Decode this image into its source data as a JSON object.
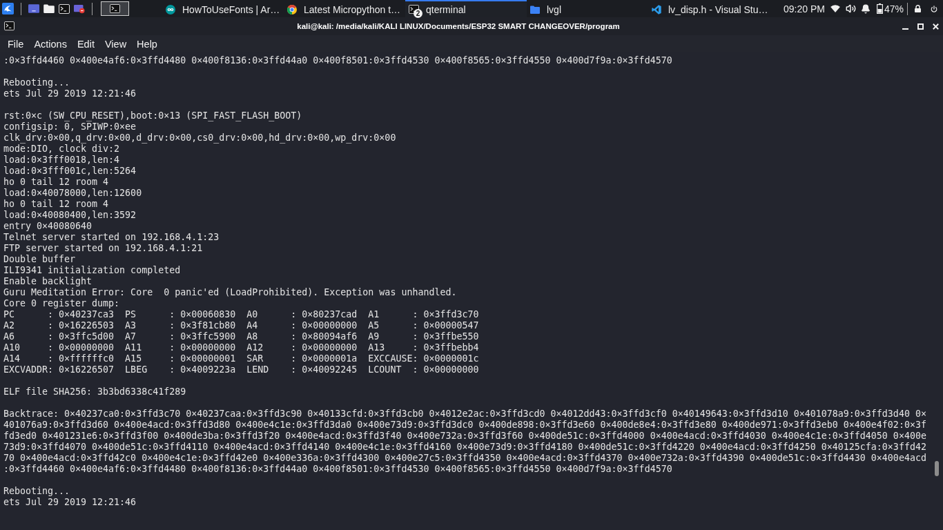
{
  "taskbar": {
    "tasks": [
      {
        "label": "HowToUseFonts | Ar…",
        "kind": "infinity",
        "selected": false
      },
      {
        "label": "Latest Micropython t…",
        "kind": "browser",
        "selected": false
      },
      {
        "label": "qterminal",
        "kind": "terminal",
        "selected": true,
        "count": "2"
      },
      {
        "label": "lvgl",
        "kind": "folder",
        "selected": false
      },
      {
        "label": "lv_disp.h - Visual Stu…",
        "kind": "editor",
        "selected": false
      }
    ],
    "clock": "09:20 PM",
    "battery": "47%"
  },
  "window": {
    "title": "kali@kali: /media/kali/KALI LINUX/Documents/ESP32 SMART CHANGEOVER/program",
    "menu": [
      "File",
      "Actions",
      "Edit",
      "View",
      "Help"
    ]
  },
  "terminal": {
    "blocks": [
      [
        ":0×3ffd4460 0×400e4af6:0×3ffd4480 0×400f8136:0×3ffd44a0 0×400f8501:0×3ffd4530 0×400f8565:0×3ffd4550 0×400d7f9a:0×3ffd4570"
      ],
      [
        "Rebooting...",
        "ets Jul 29 2019 12:21:46"
      ],
      [
        "rst:0×c (SW_CPU_RESET),boot:0×13 (SPI_FAST_FLASH_BOOT)",
        "configsip: 0, SPIWP:0×ee",
        "clk_drv:0×00,q_drv:0×00,d_drv:0×00,cs0_drv:0×00,hd_drv:0×00,wp_drv:0×00",
        "mode:DIO, clock div:2",
        "load:0×3fff0018,len:4",
        "load:0×3fff001c,len:5264",
        "ho 0 tail 12 room 4",
        "load:0×40078000,len:12600",
        "ho 0 tail 12 room 4",
        "load:0×40080400,len:3592",
        "entry 0×40080640",
        "Telnet server started on 192.168.4.1:23",
        "FTP server started on 192.168.4.1:21",
        "Double buffer",
        "ILI9341 initialization completed",
        "Enable backlight",
        "Guru Meditation Error: Core  0 panic'ed (LoadProhibited). Exception was unhandled.",
        "Core 0 register dump:",
        "PC      : 0×40237ca3  PS      : 0×00060830  A0      : 0×80237cad  A1      : 0×3ffd3c70",
        "A2      : 0×16226503  A3      : 0×3f81cb80  A4      : 0×00000000  A5      : 0×00000547",
        "A6      : 0×3ffc5d00  A7      : 0×3ffc5900  A8      : 0×80094af6  A9      : 0×3ffbe550",
        "A10     : 0×00000000  A11     : 0×00000000  A12     : 0×00000000  A13     : 0×3ffbebb4",
        "A14     : 0×ffffffc0  A15     : 0×00000001  SAR     : 0×0000001a  EXCCAUSE: 0×0000001c",
        "EXCVADDR: 0×16226507  LBEG    : 0×4009223a  LEND    : 0×40092245  LCOUNT  : 0×00000000"
      ],
      [
        "ELF file SHA256: 3b3bd6338c41f289"
      ],
      [
        "Backtrace: 0×40237ca0:0×3ffd3c70 0×40237caa:0×3ffd3c90 0×40133cfd:0×3ffd3cb0 0×4012e2ac:0×3ffd3cd0 0×4012dd43:0×3ffd3cf0 0×40149643:0×3ffd3d10 0×401078a9:0×3ffd3d40 0×401076a9:0×3ffd3d60 0×400e4acd:0×3ffd3d80 0×400e4c1e:0×3ffd3da0 0×400e73d9:0×3ffd3dc0 0×400de898:0×3ffd3e60 0×400de8e4:0×3ffd3e80 0×400de971:0×3ffd3eb0 0×400e4f02:0×3ffd3ed0 0×401231e6:0×3ffd3f00 0×400de3ba:0×3ffd3f20 0×400e4acd:0×3ffd3f40 0×400e732a:0×3ffd3f60 0×400de51c:0×3ffd4000 0×400e4acd:0×3ffd4030 0×400e4c1e:0×3ffd4050 0×400e73d9:0×3ffd4070 0×400de51c:0×3ffd4110 0×400e4acd:0×3ffd4140 0×400e4c1e:0×3ffd4160 0×400e73d9:0×3ffd4180 0×400de51c:0×3ffd4220 0×400e4acd:0×3ffd4250 0×40125cfa:0×3ffd4270 0×400e4acd:0×3ffd42c0 0×400e4c1e:0×3ffd42e0 0×400e336a:0×3ffd4300 0×400e27c5:0×3ffd4350 0×400e4acd:0×3ffd4370 0×400e732a:0×3ffd4390 0×400de51c:0×3ffd4430 0×400e4acd:0×3ffd4460 0×400e4af6:0×3ffd4480 0×400f8136:0×3ffd44a0 0×400f8501:0×3ffd4530 0×400f8565:0×3ffd4550 0×400d7f9a:0×3ffd4570"
      ],
      [
        "Rebooting...",
        "ets Jul 29 2019 12:21:46"
      ]
    ]
  }
}
